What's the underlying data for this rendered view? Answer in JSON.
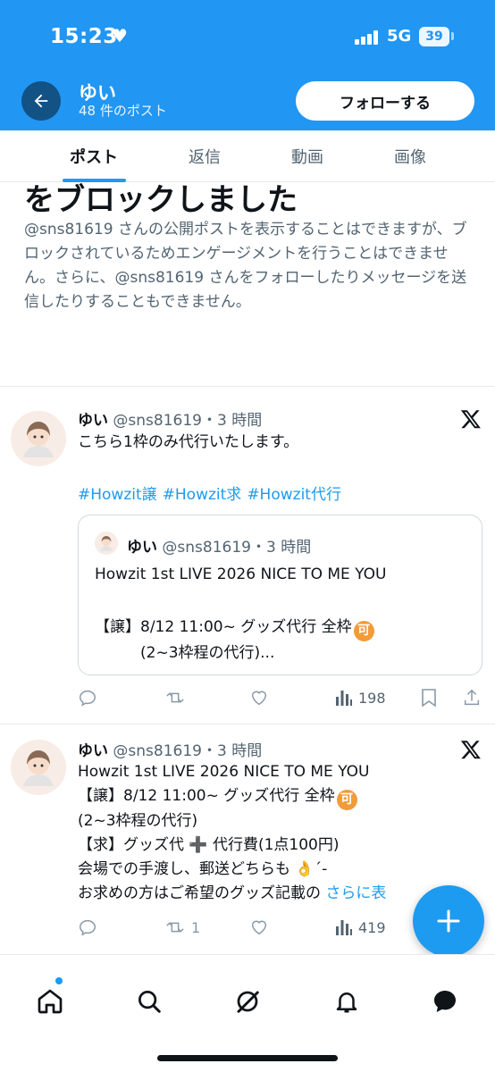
{
  "status_bar": {
    "time": "15:23",
    "network": "5G",
    "battery": "39"
  },
  "header": {
    "name": "ゆい",
    "post_count": "48 件のポスト",
    "follow_label": "フォローする"
  },
  "tabs": [
    {
      "label": "ポスト"
    },
    {
      "label": "返信"
    },
    {
      "label": "動画"
    },
    {
      "label": "画像"
    }
  ],
  "blocked": {
    "title": "をブロックしました",
    "body": "@sns81619 さんの公開ポストを表示することはできますが、ブロックされているためエンゲージメントを行うことはできません。さらに、@sns81619 さんをフォローしたりメッセージを送信したりすることもできません。"
  },
  "posts": [
    {
      "name": "ゆい",
      "meta": "@sns81619・3 時間",
      "text": "こちら1枠のみ代行いたします。",
      "hashtags": [
        "#Howzit譲",
        "#Howzit求",
        "#Howzit代行"
      ],
      "quote": {
        "name": "ゆい",
        "meta": "@sns81619・3 時間",
        "line1": "Howzit 1st LIVE 2026 NICE TO ME YOU",
        "line2": "【譲】8/12 11:00~ グッズ代行 全枠",
        "badge": "可",
        "line3": "(2~3枠程の代行)..."
      },
      "views": "198"
    },
    {
      "name": "ゆい",
      "meta": "@sns81619・3 時間",
      "lines": [
        "Howzit 1st LIVE 2026 NICE TO ME YOU",
        "【譲】8/12 11:00~ グッズ代行 全枠",
        "(2~3枠程の代行)",
        "【求】グッズ代 ➕ 代行費(1点100円)",
        "会場での手渡し、郵送どちらも 👌´-",
        "お求めの方はご希望のグッズ記載の"
      ],
      "badge": "可",
      "more": "さらに表",
      "retweets": "1",
      "views": "419"
    }
  ],
  "colors": {
    "header_bg": "#2196f3",
    "accent": "#1d9bf0"
  },
  "icons": [
    "back-arrow-icon",
    "x-logo-icon",
    "reply-icon",
    "retweet-icon",
    "like-icon",
    "views-icon",
    "bookmark-icon",
    "share-icon",
    "compose-plus-icon",
    "home-icon",
    "search-icon",
    "grok-icon",
    "notifications-icon",
    "messages-icon"
  ]
}
